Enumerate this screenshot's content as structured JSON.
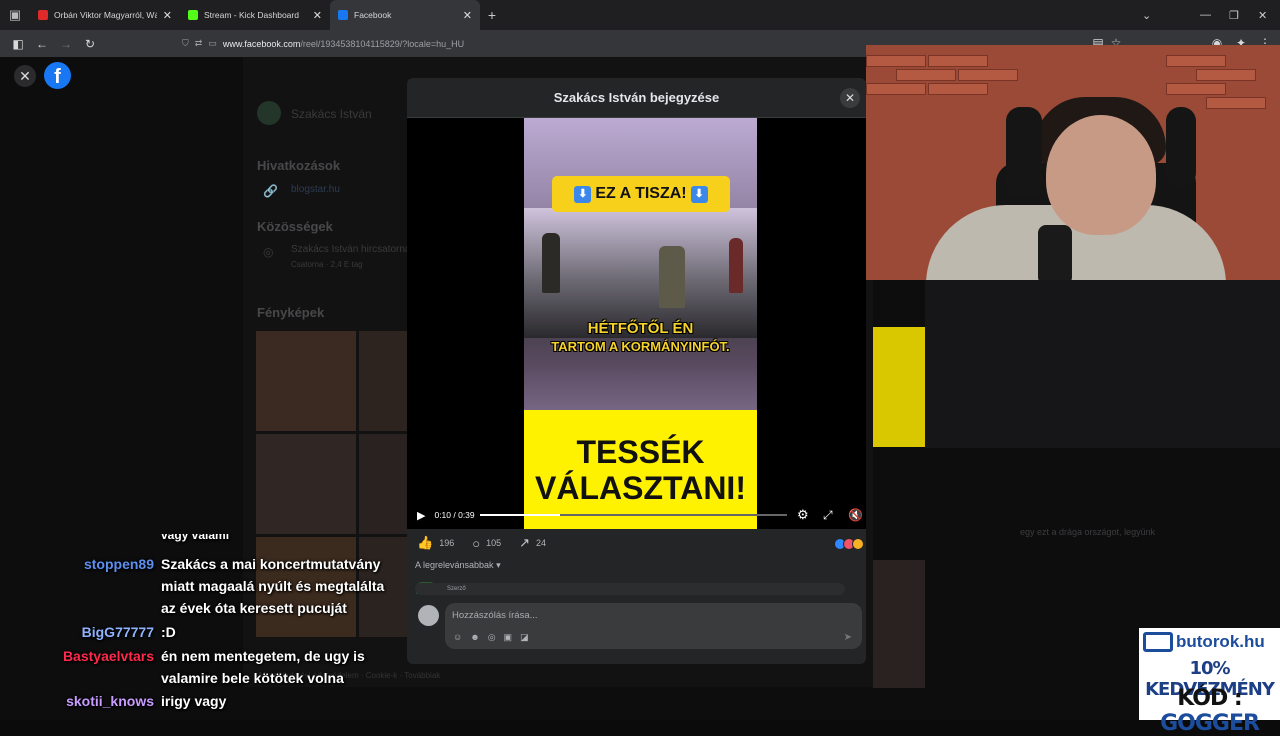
{
  "browser": {
    "tabs": [
      {
        "label": "Orbán Viktor Magyarról, Wáber",
        "favicon_color": "#e02a2a",
        "active": false
      },
      {
        "label": "Stream - Kick Dashboard",
        "favicon_color": "#53fc18",
        "active": false
      },
      {
        "label": "Facebook",
        "favicon_color": "#1877f2",
        "active": true
      }
    ],
    "url_host": "www.facebook.com",
    "url_path": "/reel/1934538104115829/?locale=hu_HU"
  },
  "fb_background": {
    "profile_name": "Szakács István",
    "links_heading": "Hivatkozások",
    "link": "blogstar.hu",
    "communities_heading": "Közösségek",
    "community_name": "Szakács István hircsatorna",
    "community_sub": "Csatorna · 2,4 E tag",
    "photos_heading": "Fényképek",
    "footer_text": "Meta Hirdetési adatvédelem · Cookie-k · Továbbiak",
    "side_text": "egy ezt a drága országot, legyünk"
  },
  "modal": {
    "title": "Szakács István bejegyzése",
    "video": {
      "banner": "EZ A TISZA!",
      "caption_lines": [
        "HÉTFŐTŐL ÉN",
        "TARTOM A KORMÁNYINFÓT."
      ],
      "yellow_lines": [
        "TESSÉK",
        "VÁLASZTANI!"
      ],
      "time": "0:10 / 0:39",
      "progress": 0.26
    },
    "likes": "196",
    "comments": "105",
    "shares": "24",
    "sort_label": "A legrelevánsabbak",
    "author_tag": "Szerző",
    "comment_placeholder": "Hozzászólás írása...",
    "reaction_colors": [
      "#2e89ff",
      "#f25268",
      "#f7b125"
    ]
  },
  "chat": [
    {
      "name": "stoppen89",
      "color": "#5b8ff0",
      "lines": [
        "Szakács a mai koncertmutatvány",
        "miatt magaalá nyúlt és megtalálta",
        "az évek óta keresett pucuját"
      ]
    },
    {
      "name": "BigG77777",
      "color": "#8fb2ff",
      "lines": [
        ":D"
      ]
    },
    {
      "name": "Bastyaelvtars",
      "color": "#ff2a4a",
      "lines": [
        "én nem mentegetem, de ugy is",
        "valamire bele kötötek volna"
      ]
    },
    {
      "name": "skotii_knows",
      "color": "#c99cff",
      "lines": [
        "irigy vagy"
      ]
    }
  ],
  "ad": {
    "brand": "butorok.hu",
    "line1": "10% KEDVEZMÉNY",
    "line2_prefix": "KÓD : ",
    "line2_code": "GOGGER"
  }
}
